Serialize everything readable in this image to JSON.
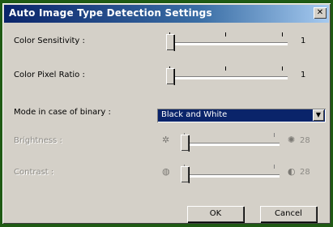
{
  "dialog": {
    "title": "Auto Image Type Detection Settings",
    "close_glyph": "✕"
  },
  "color_sensitivity": {
    "label": "Color Sensitivity :",
    "value": "1",
    "level": 0
  },
  "color_pixel_ratio": {
    "label": "Color Pixel Ratio :",
    "value": "1",
    "level": 0
  },
  "binary_mode": {
    "label": "Mode in case of binary :",
    "selected": "Black and White",
    "arrow_glyph": "▼"
  },
  "brightness": {
    "label": "Brightness :",
    "icon_left": "sun-small-icon",
    "icon_right": "sun-large-icon",
    "icon_left_glyph": "✲",
    "icon_right_glyph": "✺",
    "value": "28",
    "enabled": false
  },
  "contrast": {
    "label": "Contrast :",
    "icon_left": "contrast-low-icon",
    "icon_right": "contrast-high-icon",
    "icon_left_glyph": "◍",
    "icon_right_glyph": "◐",
    "value": "28",
    "enabled": false
  },
  "buttons": {
    "ok": "OK",
    "cancel": "Cancel"
  },
  "colors": {
    "desktop": "#1f5a14",
    "face": "#d4d0c8",
    "title_start": "#0a246a",
    "selection": "#0a246a"
  }
}
